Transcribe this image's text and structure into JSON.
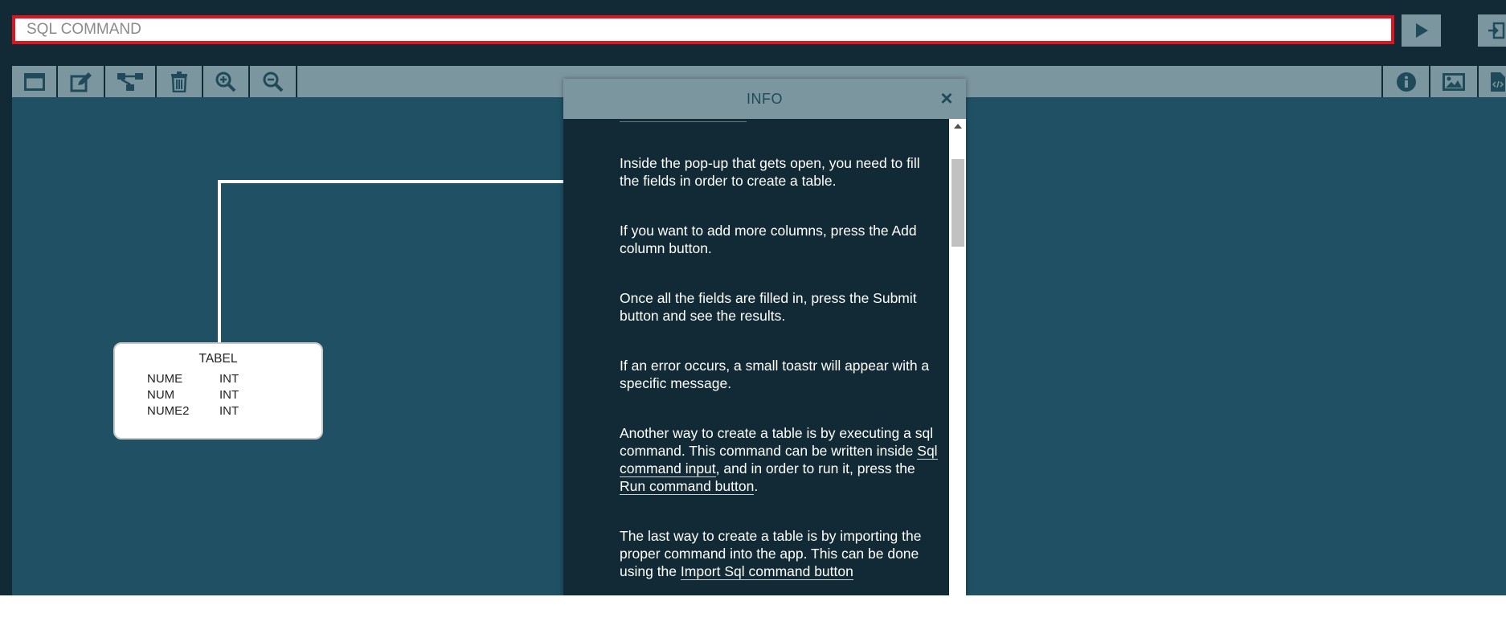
{
  "command_bar": {
    "sql_placeholder": "SQL COMMAND",
    "sql_value": "",
    "run_icon": "play-icon",
    "import_icon": "import-file-icon"
  },
  "toolbar": {
    "left_icons": [
      "window-icon",
      "edit-icon",
      "relation-icon",
      "trash-icon",
      "zoom-in-icon",
      "zoom-out-icon"
    ],
    "right_icons": [
      "info-icon",
      "image-icon",
      "code-file-icon"
    ]
  },
  "table_entity": {
    "name": "TABEL",
    "columns": [
      {
        "name": "NUME",
        "type": "INT"
      },
      {
        "name": "NUM",
        "type": "INT"
      },
      {
        "name": "NUME2",
        "type": "INT"
      }
    ]
  },
  "info_panel": {
    "title": "INFO",
    "close_label": "×",
    "p1": "Inside the pop-up that gets open, you need to fill the fields in order to create a table.",
    "p2": "If you want to add more columns, press the Add column button.",
    "p3": "Once all the fields are filled in, press the Submit button and see the results.",
    "p4": "If an error occurs, a small toastr will appear with a specific message.",
    "p5_a": "Another way to create a table is by executing a sql command. This command can be written inside ",
    "p5_link1": "Sql command input",
    "p5_b": ", and in order to run it, press the ",
    "p5_link2": "Run command button",
    "p5_c": ".",
    "p6_a": "The last way to create a table is by importing the proper command into the app. This can be done using the ",
    "p6_link": "Import Sql command button"
  },
  "colors": {
    "background": "#122a35",
    "canvas": "#1f5064",
    "toolbar": "#7c96a0",
    "input_border": "#e0141e",
    "icon": "#1f4a5a"
  }
}
